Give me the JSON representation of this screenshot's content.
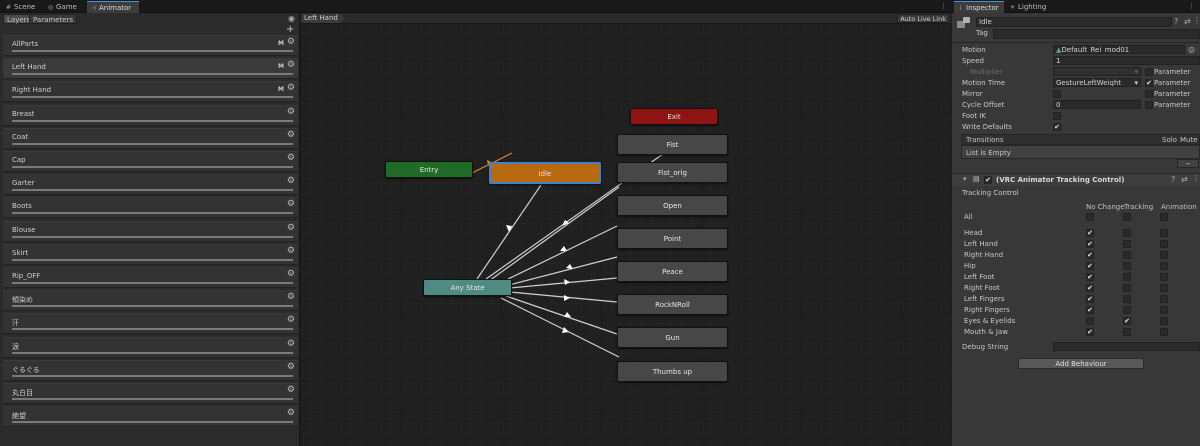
{
  "left_tabs": [
    {
      "icon": "#",
      "label": "Scene"
    },
    {
      "icon": "◎",
      "label": "Game"
    },
    {
      "icon": "⊣",
      "label": "Animator"
    }
  ],
  "right_tabs": [
    {
      "icon": "i",
      "label": "Inspector"
    },
    {
      "icon": "☀",
      "label": "Lighting"
    }
  ],
  "animator": {
    "sub_tabs": [
      "Layers",
      "Parameters"
    ],
    "add_symbol": "+",
    "layers": [
      {
        "name": "AllParts",
        "m": "M"
      },
      {
        "name": "Left Hand",
        "m": "M"
      },
      {
        "name": "Right Hand",
        "m": "M"
      },
      {
        "name": "Breast",
        "m": ""
      },
      {
        "name": "Coat",
        "m": ""
      },
      {
        "name": "Cap",
        "m": ""
      },
      {
        "name": "Garter",
        "m": ""
      },
      {
        "name": "Boots",
        "m": ""
      },
      {
        "name": "Blouse",
        "m": ""
      },
      {
        "name": "Skirt",
        "m": ""
      },
      {
        "name": "Rip_OFF",
        "m": ""
      },
      {
        "name": "頬染め",
        "m": ""
      },
      {
        "name": "汗",
        "m": ""
      },
      {
        "name": "涙",
        "m": ""
      },
      {
        "name": "ぐるぐる",
        "m": ""
      },
      {
        "name": "丸白目",
        "m": ""
      },
      {
        "name": "絶望",
        "m": ""
      }
    ],
    "breadcrumb": "Left Hand",
    "auto_live_link": "Auto Live Link",
    "states": {
      "exit": "Exit",
      "entry": "Entry",
      "idle": "Idle",
      "any_state": "Any State",
      "fist": "Fist",
      "fist_orig": "Fist_orig",
      "open": "Open",
      "point": "Point",
      "peace": "Peace",
      "rocknroll": "RockNRoll",
      "gun": "Gun",
      "thumbs_up": "Thumbs up"
    },
    "colors": {
      "entry": "#1f6b27",
      "exit": "#8f1313",
      "idle": "#b8690f",
      "idle_border": "#3e82cc",
      "any_state": "#4e8c83",
      "state": "#474747"
    }
  },
  "inspector": {
    "name": "Idle",
    "tag_label": "Tag",
    "fields": {
      "motion_label": "Motion",
      "motion_value": "Default_Rei_mod01",
      "speed_label": "Speed",
      "speed_value": "1",
      "multiplier_label": "Multiplier",
      "motion_time_label": "Motion Time",
      "motion_time_value": "GestureLeftWeight",
      "mirror_label": "Mirror",
      "cycle_offset_label": "Cycle Offset",
      "cycle_offset_value": "0",
      "foot_ik_label": "Foot IK",
      "write_defaults_label": "Write Defaults",
      "parameter_label": "Parameter"
    },
    "transitions": {
      "label": "Transitions",
      "solo": "Solo",
      "mute": "Mute",
      "empty": "List is Empty",
      "minus": "−"
    },
    "behaviour": {
      "title": "(VRC Animator Tracking Control)",
      "section": "Tracking Control",
      "col_no_change": "No Change",
      "col_tracking": "Tracking",
      "col_animation": "Animation",
      "rows": [
        {
          "label": "All",
          "no_change": false,
          "tracking": false,
          "animation": false
        },
        {
          "label": "Head",
          "no_change": true,
          "tracking": false,
          "animation": false
        },
        {
          "label": "Left Hand",
          "no_change": true,
          "tracking": false,
          "animation": false
        },
        {
          "label": "Right Hand",
          "no_change": true,
          "tracking": false,
          "animation": false
        },
        {
          "label": "Hip",
          "no_change": true,
          "tracking": false,
          "animation": false
        },
        {
          "label": "Left Foot",
          "no_change": true,
          "tracking": false,
          "animation": false
        },
        {
          "label": "Right Foot",
          "no_change": true,
          "tracking": false,
          "animation": false
        },
        {
          "label": "Left Fingers",
          "no_change": true,
          "tracking": false,
          "animation": false
        },
        {
          "label": "Right Fingers",
          "no_change": true,
          "tracking": false,
          "animation": false
        },
        {
          "label": "Eyes & Eyelids",
          "no_change": false,
          "tracking": true,
          "animation": false
        },
        {
          "label": "Mouth & Jaw",
          "no_change": true,
          "tracking": false,
          "animation": false
        }
      ],
      "debug_label": "Debug String",
      "add_behaviour": "Add Behaviour"
    }
  }
}
